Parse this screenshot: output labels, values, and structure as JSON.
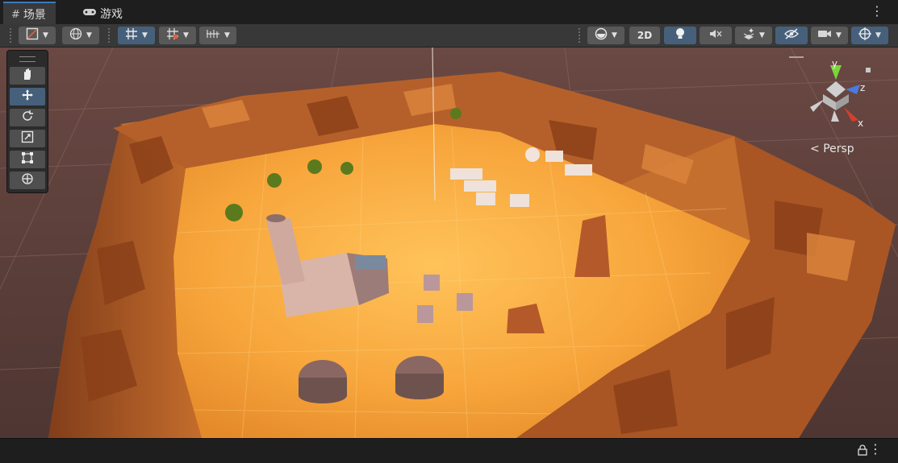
{
  "tabs": {
    "scene": {
      "label": "场景",
      "icon": "grid-icon"
    },
    "game": {
      "label": "游戏",
      "icon": "gamepad-icon"
    }
  },
  "toolbar": {
    "shading_mode": {
      "icon": "draw-mode-icon"
    },
    "global_toggle": {
      "icon": "globe-icon"
    },
    "grid_snap": {
      "icon": "grid-snap-icon"
    },
    "grid_visibility": {
      "icon": "grid-visibility-icon"
    },
    "increment_snap": {
      "icon": "increment-snap-icon"
    },
    "render_mode": {
      "icon": "render-sphere-icon"
    },
    "mode_2d_label": "2D",
    "lighting": {
      "icon": "light-bulb-icon"
    },
    "audio": {
      "icon": "audio-mute-icon"
    },
    "effects": {
      "icon": "effects-icon"
    },
    "hidden_objects": {
      "icon": "eye-hidden-icon"
    },
    "camera": {
      "icon": "camera-icon"
    },
    "gizmos": {
      "icon": "gizmo-icon"
    }
  },
  "tools": [
    {
      "name": "hand-tool",
      "icon": "hand-icon"
    },
    {
      "name": "move-tool",
      "icon": "move-icon"
    },
    {
      "name": "rotate-tool",
      "icon": "rotate-icon"
    },
    {
      "name": "scale-tool",
      "icon": "scale-icon"
    },
    {
      "name": "rect-tool",
      "icon": "rect-icon"
    },
    {
      "name": "transform-tool",
      "icon": "transform-icon"
    }
  ],
  "orientation_gizmo": {
    "x_label": "x",
    "y_label": "y",
    "z_label": "z",
    "projection_label": "Persp"
  },
  "colors": {
    "accent": "#46607c",
    "sand": "#f0a23a",
    "cliff": "#b9652b",
    "grid_bg": "#6e4a43"
  },
  "bottombar": {
    "lock_icon": "lock-icon"
  }
}
